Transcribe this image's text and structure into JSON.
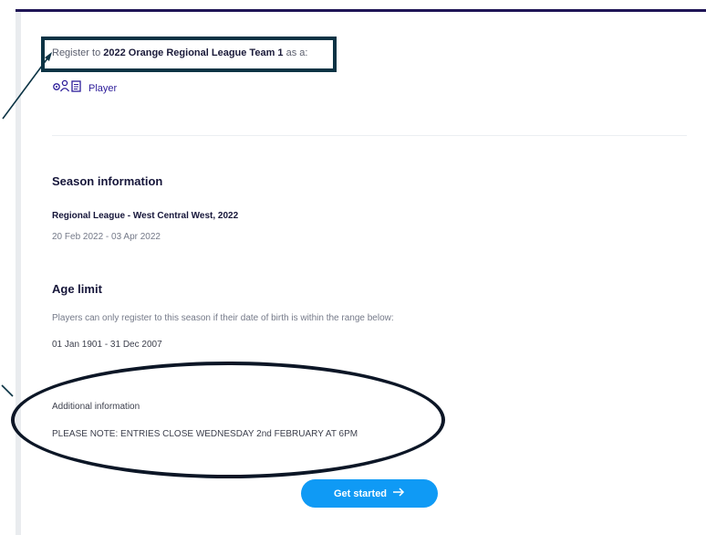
{
  "register": {
    "prefix": "Register to",
    "team": "2022 Orange Regional League Team 1",
    "suffix": "as a:"
  },
  "role": {
    "label": "Player",
    "icon": "player-role-icon"
  },
  "season": {
    "heading": "Season information",
    "name": "Regional League - West Central West, 2022",
    "dates": "20 Feb 2022 - 03 Apr 2022"
  },
  "age_limit": {
    "heading": "Age limit",
    "description": "Players can only register to this season if their date of birth is within the range below:",
    "range": "01 Jan 1901 - 31 Dec 2007"
  },
  "additional": {
    "heading": "Additional information",
    "note": "PLEASE NOTE: ENTRIES CLOSE WEDNESDAY 2nd FEBRUARY AT 6PM"
  },
  "cta": {
    "label": "Get started",
    "icon": "arrow-right-icon"
  },
  "colors": {
    "accent": "#0f9af5",
    "brand_dark": "#1f1556",
    "annotation": "#0b3344"
  }
}
